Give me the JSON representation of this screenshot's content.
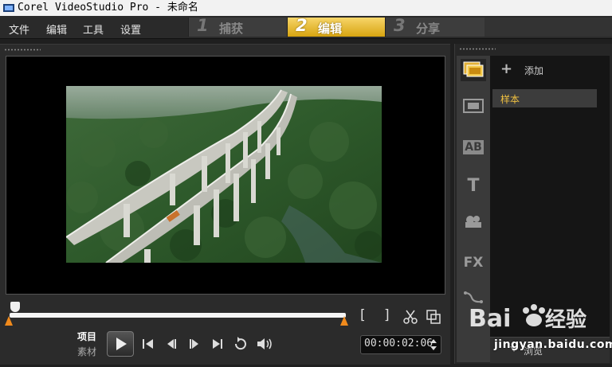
{
  "window": {
    "title": "Corel VideoStudio Pro - 未命名"
  },
  "menu": {
    "items": [
      "文件",
      "编辑",
      "工具",
      "设置"
    ]
  },
  "steps": [
    {
      "num": "1",
      "label": "捕获",
      "active": false
    },
    {
      "num": "2",
      "label": "编辑",
      "active": true
    },
    {
      "num": "3",
      "label": "分享",
      "active": false
    }
  ],
  "player": {
    "mode_project": "项目",
    "mode_clip": "素材",
    "timecode": "00:00:02:06",
    "mark_in": "[",
    "mark_out": "]",
    "progress": 0.0
  },
  "library": {
    "add_label": "添加",
    "folders": [
      "样本"
    ],
    "tabs": [
      {
        "name": "media",
        "label": ""
      },
      {
        "name": "instant-project",
        "label": ""
      },
      {
        "name": "transition",
        "label": "AB"
      },
      {
        "name": "title",
        "label": "T"
      },
      {
        "name": "graphic",
        "label": ""
      },
      {
        "name": "filter",
        "label": "FX"
      },
      {
        "name": "path",
        "label": ""
      }
    ],
    "browse_label": "浏览"
  },
  "watermark": {
    "text": "jingyan.baidu.com",
    "logo_text": "Baidu经验"
  },
  "colors": {
    "accent_active": "#e8bd2e",
    "trim_marker": "#f08a1c",
    "folder_text": "#f0c040"
  }
}
